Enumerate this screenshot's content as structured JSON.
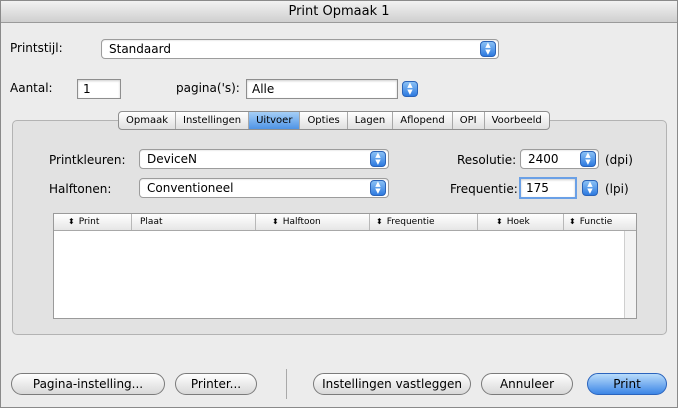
{
  "window": {
    "title": "Print Opmaak 1"
  },
  "printstijl": {
    "label": "Printstijl:",
    "value": "Standaard"
  },
  "aantal": {
    "label": "Aantal:",
    "value": "1"
  },
  "paginas": {
    "label": "pagina('s):",
    "value": "Alle"
  },
  "tabs": [
    "Opmaak",
    "Instellingen",
    "Uitvoer",
    "Opties",
    "Lagen",
    "Aflopend",
    "OPI",
    "Voorbeeld"
  ],
  "active_tab": "Uitvoer",
  "printkleuren": {
    "label": "Printkleuren:",
    "value": "DeviceN"
  },
  "halftonen": {
    "label": "Halftonen:",
    "value": "Conventioneel"
  },
  "resolutie": {
    "label": "Resolutie:",
    "value": "2400",
    "unit": "(dpi)"
  },
  "frequentie": {
    "label": "Frequentie:",
    "value": "175",
    "unit": "(lpi)"
  },
  "table": {
    "columns": [
      "Print",
      "Plaat",
      "Halftoon",
      "Frequentie",
      "Hoek",
      "Functie"
    ],
    "rows": []
  },
  "buttons": {
    "page_setup": "Pagina-instelling...",
    "printer": "Printer...",
    "capture_settings": "Instellingen vastleggen",
    "cancel": "Annuleer",
    "print": "Print"
  }
}
